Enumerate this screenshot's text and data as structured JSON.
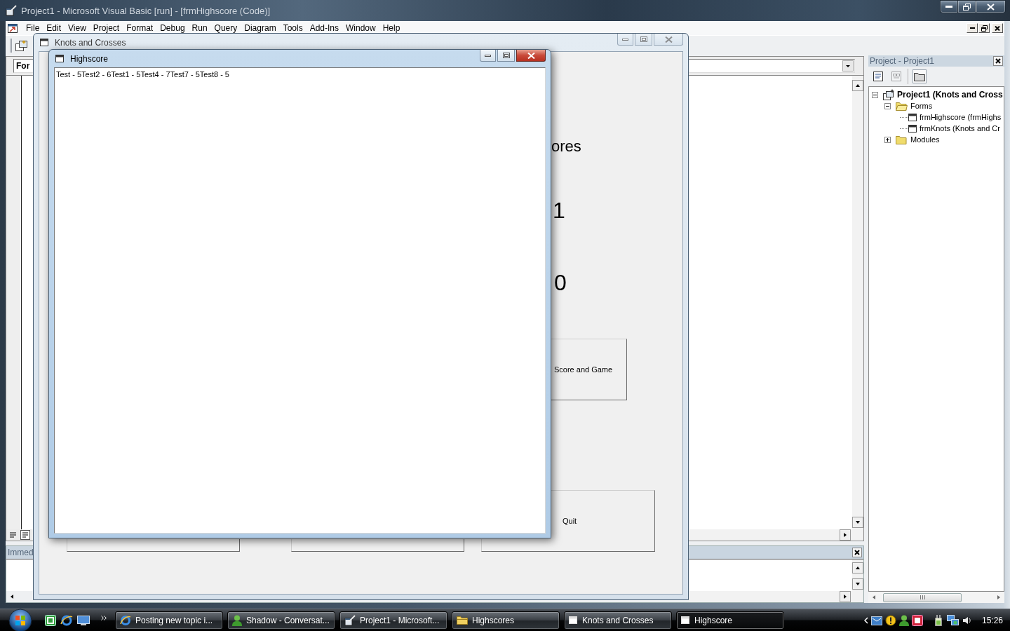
{
  "ide": {
    "title": "Project1 - Microsoft Visual Basic [run] - [frmHighscore (Code)]",
    "menu": [
      "File",
      "Edit",
      "View",
      "Project",
      "Format",
      "Debug",
      "Run",
      "Query",
      "Diagram",
      "Tools",
      "Add-Ins",
      "Window",
      "Help"
    ],
    "object_combo": "For",
    "immediate_title": "Immed"
  },
  "project_explorer": {
    "title": "Project - Project1",
    "toolbar": [
      {
        "kind": "view_code",
        "disabled": false,
        "pressed": false
      },
      {
        "kind": "view_object",
        "disabled": true,
        "pressed": false
      },
      {
        "kind": "toggle_folders",
        "disabled": false,
        "pressed": true
      }
    ],
    "tree": [
      {
        "kind": "project",
        "label": "Project1 (Knots and Cross",
        "expanded": true,
        "children": [
          {
            "kind": "folder",
            "label": "Forms",
            "expanded": true,
            "children": [
              {
                "kind": "form",
                "label": "frmHighscore (frmHighs"
              },
              {
                "kind": "form",
                "label": "frmKnots (Knots and Cr"
              }
            ]
          },
          {
            "kind": "folder",
            "label": "Modules",
            "expanded": false
          }
        ]
      }
    ]
  },
  "knots_window": {
    "title": "Knots and Crosses",
    "active": false,
    "labels": [
      {
        "kind": "title",
        "text": "ores"
      },
      {
        "kind": "score",
        "text": "1"
      },
      {
        "kind": "score",
        "text": "0"
      }
    ],
    "buttons": [
      {
        "label": "Score and Game"
      },
      {
        "label": "Quit"
      }
    ]
  },
  "highscore_window": {
    "title": "Highscore",
    "active": true,
    "text": "Test - 5Test2 - 6Test1 - 5Test4 - 7Test7 - 5Test8 - 5"
  },
  "taskbar": {
    "tasks": [
      {
        "kind": "browser",
        "label": "Posting new topic i...",
        "selected": false
      },
      {
        "kind": "messenger",
        "label": "Shadow - Conversat...",
        "selected": false
      },
      {
        "kind": "vb",
        "label": "Project1 - Microsoft...",
        "selected": false
      },
      {
        "kind": "folder",
        "label": "Highscores",
        "selected": false
      },
      {
        "kind": "form",
        "label": "Knots and Crosses",
        "selected": false
      },
      {
        "kind": "form",
        "label": "Highscore",
        "selected": true
      }
    ],
    "clock": "15:26"
  }
}
